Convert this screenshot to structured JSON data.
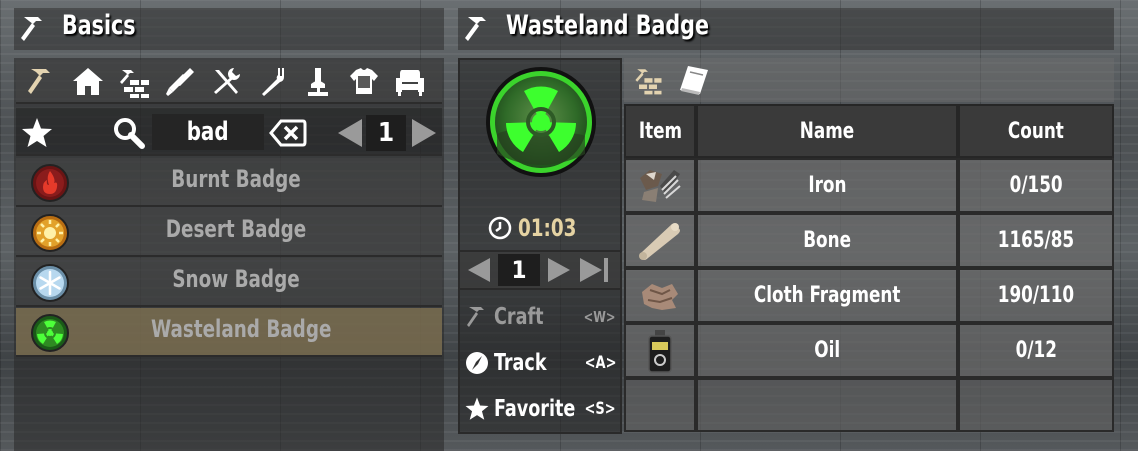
{
  "left": {
    "title": "Basics",
    "categories": [
      "hammer-icon",
      "house-icon",
      "building-blocks-icon",
      "ammo-icon",
      "tools-icon",
      "fork-icon",
      "microscope-icon",
      "armor-icon",
      "chair-icon"
    ],
    "search_value": "bad",
    "page": "1",
    "recipes": [
      {
        "name": "Burnt Badge"
      },
      {
        "name": "Desert Badge"
      },
      {
        "name": "Snow Badge"
      },
      {
        "name": "Wasteland Badge"
      }
    ]
  },
  "right": {
    "title": "Wasteland Badge",
    "craft_time": "01:03",
    "quantity": "1",
    "actions": {
      "craft": {
        "label": "Craft",
        "key": "<W>"
      },
      "track": {
        "label": "Track",
        "key": "<A>"
      },
      "favorite": {
        "label": "Favorite",
        "key": "<S>"
      }
    },
    "table": {
      "headers": {
        "item": "Item",
        "name": "Name",
        "count": "Count"
      },
      "rows": [
        {
          "name": "Iron",
          "count": "0/150"
        },
        {
          "name": "Bone",
          "count": "1165/85"
        },
        {
          "name": "Cloth Fragment",
          "count": "190/110"
        },
        {
          "name": "Oil",
          "count": "0/12"
        }
      ]
    }
  }
}
